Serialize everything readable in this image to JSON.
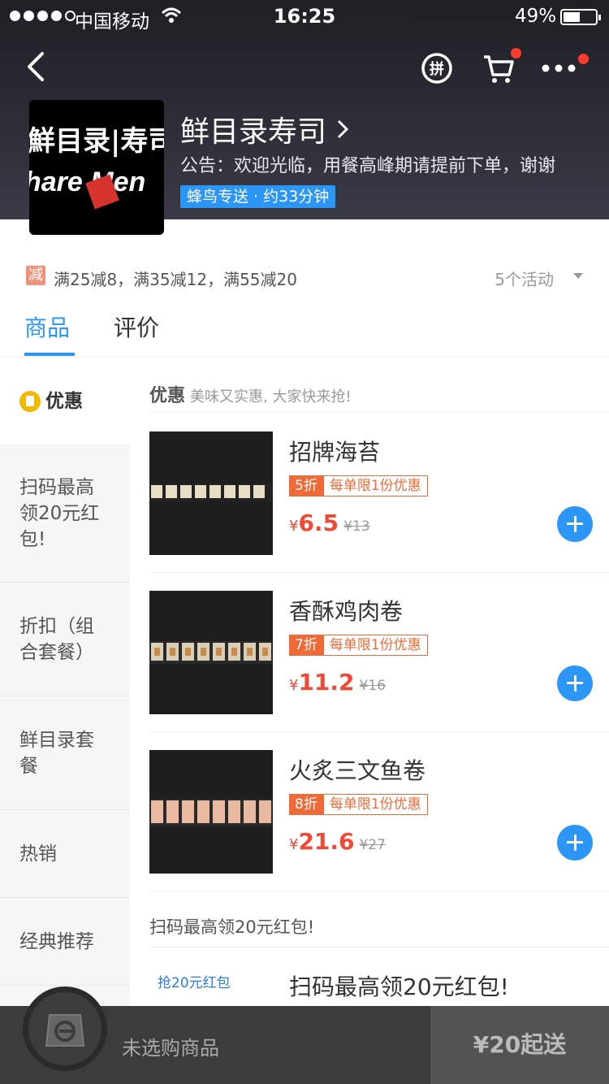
{
  "status_bar": {
    "carrier": "中国移动",
    "time": "16:25",
    "battery": "49%"
  },
  "shop": {
    "name": "鲜目录寿司",
    "notice": "公告：欢迎光临，用餐高峰期请提前下单，谢谢",
    "delivery": "蜂鸟专送 · 约33分钟",
    "logo_text_top": "鮮目录|寿司",
    "logo_text_bottom": "hare Men"
  },
  "promo": {
    "badge": "减",
    "text": "满25减8，满35减12，满55减20",
    "count": "5个活动"
  },
  "tabs": [
    {
      "label": "商品"
    },
    {
      "label": "评价"
    }
  ],
  "sidebar": {
    "items": [
      {
        "label": "优惠"
      },
      {
        "label": "扫码最高领20元红包!"
      },
      {
        "label": "折扣（组合套餐）"
      },
      {
        "label": "鲜目录套餐"
      },
      {
        "label": "热销"
      },
      {
        "label": "经典推荐"
      }
    ]
  },
  "section": {
    "title": "优惠",
    "subtitle": "美味又实惠, 大家快来抢!"
  },
  "products": [
    {
      "name": "招牌海苔",
      "discount": "5折",
      "limit": "每单限1份优惠",
      "yen": "¥",
      "price": "6.5",
      "original": "¥13"
    },
    {
      "name": "香酥鸡肉卷",
      "discount": "7折",
      "limit": "每单限1份优惠",
      "yen": "¥",
      "price": "11.2",
      "original": "¥16"
    },
    {
      "name": "火炙三文鱼卷",
      "discount": "8折",
      "limit": "每单限1份优惠",
      "yen": "¥",
      "price": "21.6",
      "original": "¥27"
    }
  ],
  "section2": {
    "title": "扫码最高领20元红包!"
  },
  "promo_card": {
    "thumb_text": "抢20元红包",
    "title": "扫码最高领20元红包!"
  },
  "bottom_bar": {
    "empty_text": "未选购商品",
    "min_order": "¥20起送"
  },
  "colors": {
    "accent": "#2c96f6",
    "price": "#ef4a36",
    "discount": "#ef6a36",
    "header_bg": "#2a2a33"
  }
}
